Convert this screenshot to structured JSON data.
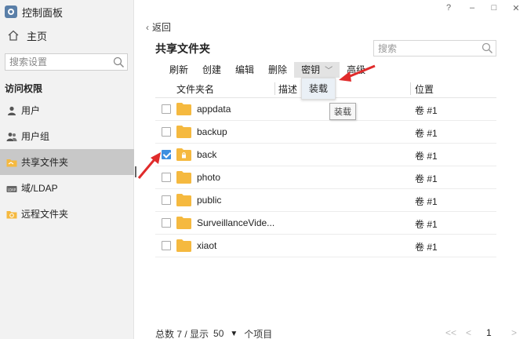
{
  "app": {
    "title": "控制面板"
  },
  "window_controls": {
    "help": "?",
    "minimize": "–",
    "maximize": "□",
    "close": "✕"
  },
  "sidebar": {
    "home_label": "主页",
    "search_placeholder": "搜索设置",
    "section_title": "访问权限",
    "items": [
      {
        "label": "用户",
        "icon": "user-icon",
        "active": false
      },
      {
        "label": "用户组",
        "icon": "user-group-icon",
        "active": false
      },
      {
        "label": "共享文件夹",
        "icon": "shared-folder-icon",
        "active": true
      },
      {
        "label": "域/LDAP",
        "icon": "ldap-icon",
        "active": false
      },
      {
        "label": "远程文件夹",
        "icon": "remote-folder-icon",
        "active": false
      }
    ]
  },
  "main": {
    "back_label": "返回",
    "title": "共享文件夹",
    "search_placeholder": "搜索",
    "toolbar": {
      "refresh": "刷新",
      "create": "创建",
      "edit": "编辑",
      "delete": "删除",
      "key": "密钥",
      "advanced": "高级"
    },
    "key_menu": {
      "items": [
        "装载"
      ],
      "tooltip": "装载"
    },
    "table": {
      "columns": [
        "文件夹名",
        "描述",
        "位置"
      ],
      "rows": [
        {
          "name": "appdata",
          "location": "卷 #1",
          "checked": false,
          "encrypted": false
        },
        {
          "name": "backup",
          "location": "卷 #1",
          "checked": false,
          "encrypted": false
        },
        {
          "name": "back",
          "location": "卷 #1",
          "checked": true,
          "encrypted": true
        },
        {
          "name": "photo",
          "location": "卷 #1",
          "checked": false,
          "encrypted": false
        },
        {
          "name": "public",
          "location": "卷 #1",
          "checked": false,
          "encrypted": false
        },
        {
          "name": "SurveillanceVide...",
          "location": "卷 #1",
          "checked": false,
          "encrypted": false
        },
        {
          "name": "xiaot",
          "location": "卷 #1",
          "checked": false,
          "encrypted": false
        }
      ]
    },
    "footer": {
      "summary": "总数 7 / 显示",
      "per_page": "50",
      "suffix": "个项目",
      "first": "<<",
      "prev": "<",
      "page": "1",
      "next": ">"
    }
  },
  "colors": {
    "accent": "#3d8fe0",
    "folder": "#f5b93f",
    "annotation_arrow": "#e02b2b",
    "sidebar_active": "#c8c8c8"
  }
}
